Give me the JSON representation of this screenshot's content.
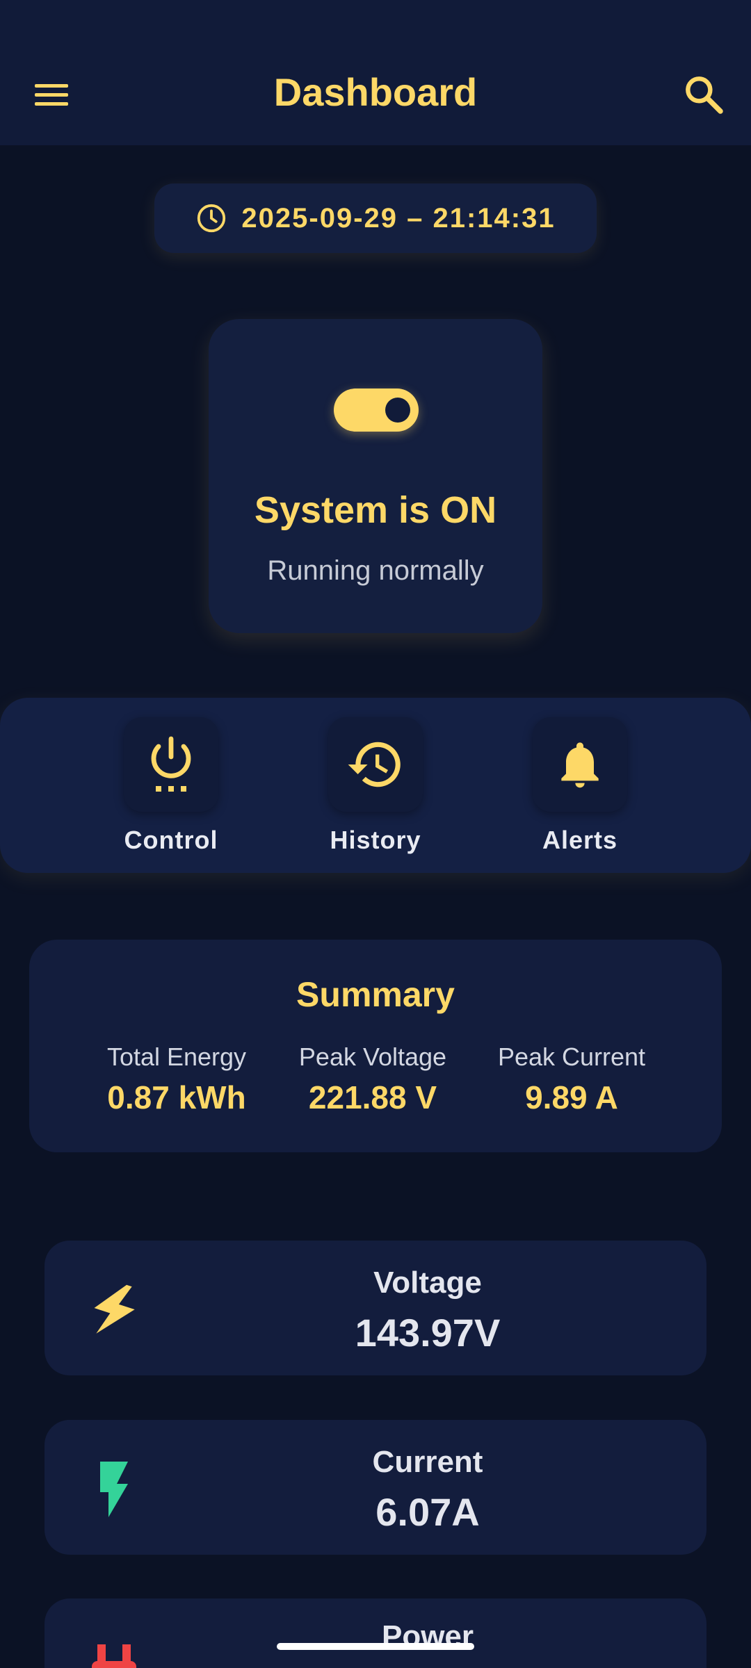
{
  "app_bar": {
    "title": "Dashboard",
    "menu_icon": "menu-icon",
    "search_icon": "search-icon",
    "accent_color": "#fdd867"
  },
  "timestamp": {
    "icon": "clock-icon",
    "value": "2025-09-29 – 21:14:31"
  },
  "system": {
    "toggle_on": true,
    "status_title": "System is ON",
    "status_subtitle": "Running normally"
  },
  "actions": [
    {
      "label": "Control",
      "icon": "power-settings-icon"
    },
    {
      "label": "History",
      "icon": "history-icon"
    },
    {
      "label": "Alerts",
      "icon": "bell-icon"
    }
  ],
  "summary": {
    "title": "Summary",
    "stats": [
      {
        "label": "Total Energy",
        "value": "0.87 kWh"
      },
      {
        "label": "Peak Voltage",
        "value": "221.88 V"
      },
      {
        "label": "Peak Current",
        "value": "9.89 A"
      }
    ]
  },
  "metrics": [
    {
      "label": "Voltage",
      "value": "143.97V",
      "icon": "lightning-icon",
      "icon_color": "#fdd867"
    },
    {
      "label": "Current",
      "value": "6.07A",
      "icon": "flash-icon",
      "icon_color": "#34d399"
    },
    {
      "label": "Power",
      "value": "",
      "icon": "plug-icon",
      "icon_color": "#ef4444"
    }
  ]
}
